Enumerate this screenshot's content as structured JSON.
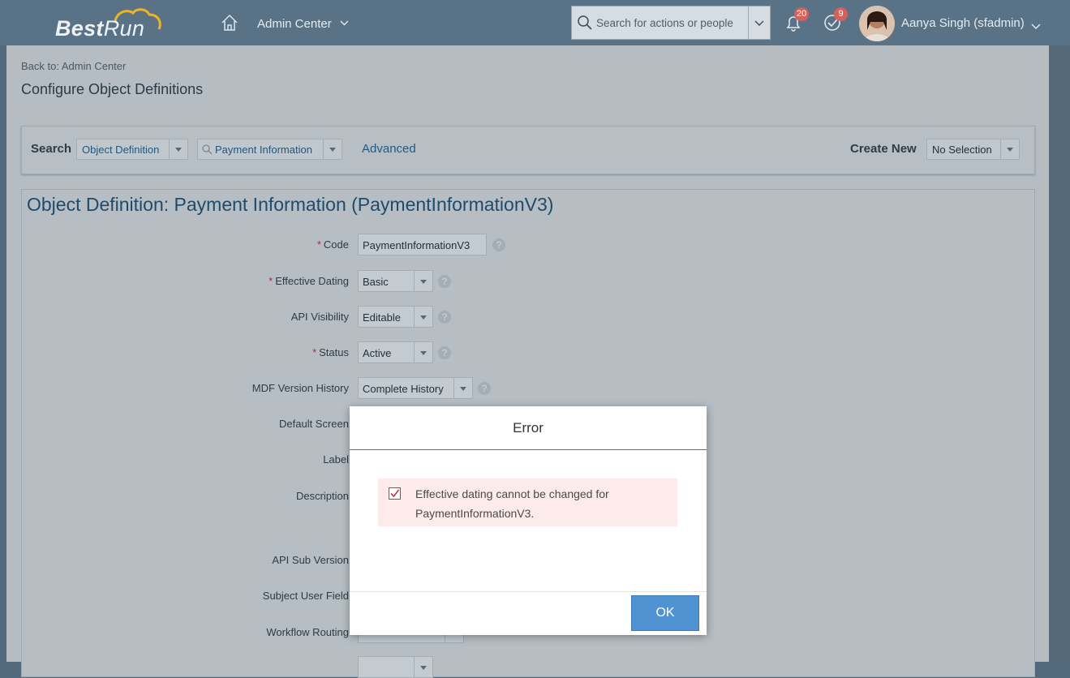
{
  "shell": {
    "logo_main": "Best",
    "logo_accent": "Run",
    "menu_label": "Admin Center",
    "search_placeholder": "Search for actions or people",
    "notifications_count": "20",
    "todo_count": "9",
    "user_name": "Aanya Singh (sfadmin)"
  },
  "page": {
    "back_link": "Back to: Admin Center",
    "title": "Configure Object Definitions"
  },
  "search_panel": {
    "search_label": "Search",
    "type_value": "Object Definition",
    "object_value": "Payment Information",
    "advanced_link": "Advanced",
    "create_new_label": "Create New",
    "create_new_value": "No Selection"
  },
  "definition": {
    "title": "Object Definition: Payment Information  (PaymentInformationV3)",
    "fields": {
      "code": {
        "label": "Code",
        "value": "PaymentInformationV3"
      },
      "effective_dating": {
        "label": "Effective Dating",
        "value": "Basic"
      },
      "api_visibility": {
        "label": "API Visibility",
        "value": "Editable"
      },
      "status": {
        "label": "Status",
        "value": "Active"
      },
      "mdf_version_history": {
        "label": "MDF Version History",
        "value": "Complete History"
      },
      "default_screen": {
        "label": "Default Screen"
      },
      "label": {
        "label": "Label"
      },
      "description": {
        "label": "Description"
      },
      "api_sub_version": {
        "label": "API Sub Version"
      },
      "subject_user_field": {
        "label": "Subject User Field"
      },
      "workflow_routing": {
        "label": "Workflow Routing"
      }
    }
  },
  "dialog": {
    "title": "Error",
    "message": "Effective dating cannot be changed for PaymentInformationV3.",
    "ok_label": "OK"
  },
  "colors": {
    "shell": "#5a7285",
    "accent_blue": "#4f93d3",
    "error_bg": "#fdeaea",
    "required": "#b4283b"
  }
}
